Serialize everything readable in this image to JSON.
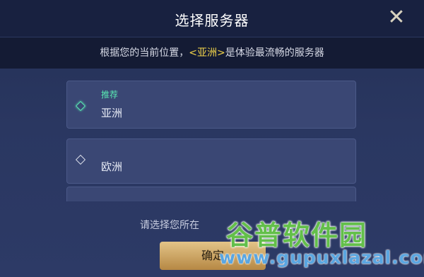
{
  "dialog": {
    "title": "选择服务器",
    "close_icon": "close-icon",
    "notice_prefix": "根据您的当前位置，",
    "notice_highlight": "<亚洲>",
    "notice_suffix": "是体验最流畅的服务器"
  },
  "servers": [
    {
      "tag": "推荐",
      "name": "亚洲",
      "icon": "diamond-icon"
    },
    {
      "tag": "",
      "name": "欧洲",
      "icon": "diamond-icon"
    }
  ],
  "footer": {
    "hint": "请选择您所在",
    "confirm_label": "确定"
  },
  "watermark": {
    "text": "谷普软件园",
    "url": "www.gupuxlazal.com"
  },
  "colors": {
    "accent_highlight": "#f2d44a",
    "recommended": "#59e8b2",
    "confirm_button": "#c9a35f"
  }
}
